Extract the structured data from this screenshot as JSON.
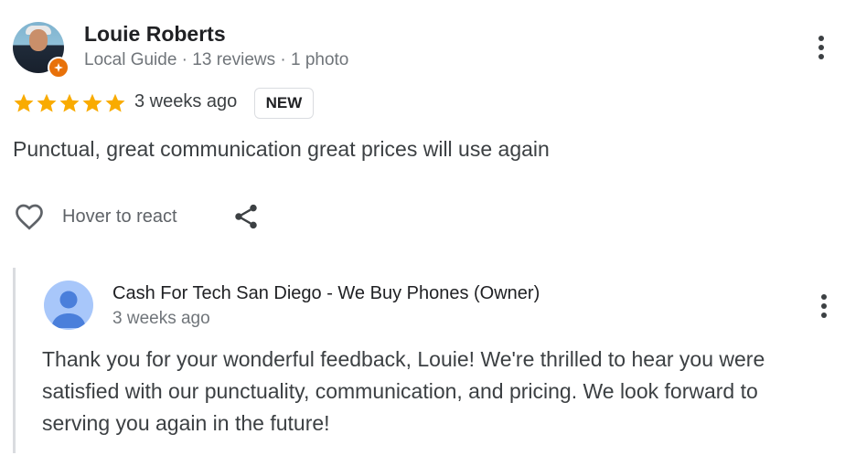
{
  "reviewer": {
    "name": "Louie Roberts",
    "meta": "Local Guide · 13 reviews · 1 photo",
    "rating": 5,
    "date": "3 weeks ago",
    "badge": "NEW",
    "text": "Punctual, great communication great prices will use again"
  },
  "actions": {
    "react_label": "Hover to react"
  },
  "reply": {
    "owner_name": "Cash For Tech San Diego - We Buy Phones (Owner)",
    "date": "3 weeks ago",
    "text": "Thank you for your wonderful feedback, Louie! We're thrilled to hear you were satisfied with our punctuality, communication, and pricing. We look forward to serving you again in the future!"
  },
  "colors": {
    "star": "#f9ab00",
    "guide_badge": "#e8710a",
    "owner_avatar_bg": "#a8c7fa",
    "owner_avatar_fg": "#4a7fdb"
  },
  "icons": [
    "star-icon",
    "local-guide-badge-icon",
    "more-options-icon",
    "heart-icon",
    "share-icon",
    "default-profile-icon"
  ]
}
